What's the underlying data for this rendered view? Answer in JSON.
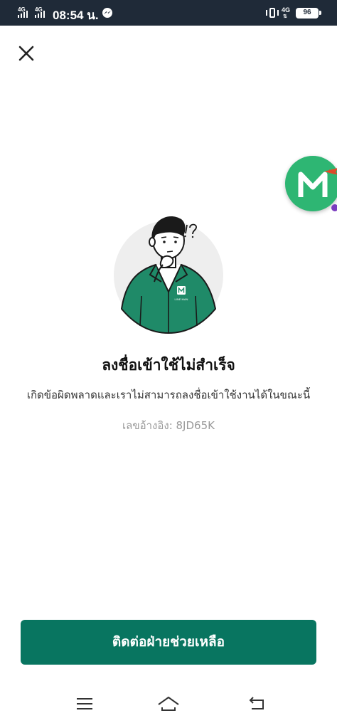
{
  "status_bar": {
    "sim1_label": "4G",
    "sim2_label": "4G",
    "time": "08:54 น.",
    "network_label": "4G",
    "battery": "96",
    "icons": [
      "signal-icon",
      "messenger-icon",
      "vibrate-icon",
      "battery-icon"
    ]
  },
  "dialog": {
    "title": "ลงชื่อเข้าใช้ไม่สำเร็จ",
    "message": "เกิดข้อผิดพลาดและเราไม่สามารถลงชื่อเข้าใช้งานได้ในขณะนี้",
    "reference": "เลขอ้างอิง: 8JD65K",
    "badge_text": "LINE MAN",
    "contact_button_label": "ติดต่อฝ่ายช่วยเหลือ"
  },
  "floating_bubble": {
    "letter": "M"
  },
  "colors": {
    "status_bar": "#1f2a38",
    "brand_green": "#087560",
    "bubble_green": "#2eb673"
  }
}
